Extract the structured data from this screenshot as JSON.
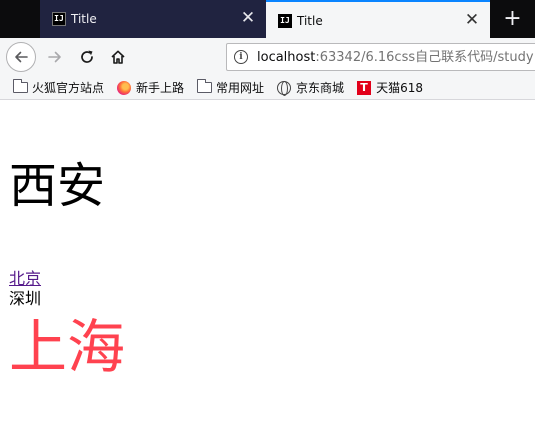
{
  "tabs": [
    {
      "title": "Title",
      "favicon_text": "IJ",
      "active": false
    },
    {
      "title": "Title",
      "favicon_text": "IJ",
      "active": true
    }
  ],
  "tabstrip": {
    "close_glyph": "✕",
    "new_tab_glyph": "+"
  },
  "navbar": {
    "back_glyph": "←",
    "forward_glyph": "→",
    "reload_glyph": "↻",
    "home_icon": "home-icon",
    "info_glyph": "i",
    "url_host": "localhost",
    "url_rest": ":63342/6.16css自己联系代码/study"
  },
  "bookmarks": [
    {
      "label": "火狐官方站点",
      "icon": "folder-icon"
    },
    {
      "label": "新手上路",
      "icon": "firefox-icon"
    },
    {
      "label": "常用网址",
      "icon": "folder-icon"
    },
    {
      "label": "京东商城",
      "icon": "globe-icon"
    },
    {
      "label": "天猫618",
      "icon": "tmall-icon",
      "icon_text": "T"
    }
  ],
  "page": {
    "heading": "西安",
    "link": "北京",
    "text1": "深圳",
    "text2": "上海"
  },
  "colors": {
    "tab_active_accent": "#0a84ff",
    "tabstrip_bg": "#0c0c0d",
    "tab_inactive_bg": "#202340",
    "chrome_bg": "#f5f6f7",
    "visited_link": "#551a8b",
    "shanghai_red": "#ff424f"
  }
}
